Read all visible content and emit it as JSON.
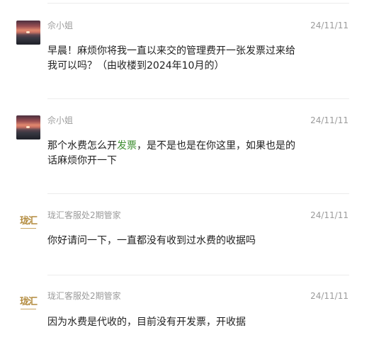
{
  "messages": [
    {
      "sender": "佘小姐",
      "date": "24/11/11",
      "avatar": "sunset-photo",
      "text": "早晨！麻烦你将我一直以来交的管理费开一张发票过来给\n我可以吗？（由收楼到2024年10月的）"
    },
    {
      "sender": "佘小姐",
      "date": "24/11/11",
      "avatar": "sunset-photo",
      "text_before": "那个水费怎么开",
      "text_link": "发票",
      "text_after": "，是不是也是在你这里，如果也是的\n话麻烦你开一下"
    },
    {
      "sender": "珑汇客服处2期管家",
      "date": "24/11/11",
      "avatar": "lunghui-logo",
      "text": "你好请问一下，一直都没有收到过水费的收据吗"
    },
    {
      "sender": "珑汇客服处2期管家",
      "date": "24/11/11",
      "avatar": "lunghui-logo",
      "text": "因为水费是代收的，目前没有开发票，开收据"
    }
  ],
  "logo_text": "珑汇",
  "colors": {
    "link": "#3c8d2f",
    "meta": "#9b9b9b",
    "text": "#1f1f1f",
    "logo": "#b38b3e"
  }
}
